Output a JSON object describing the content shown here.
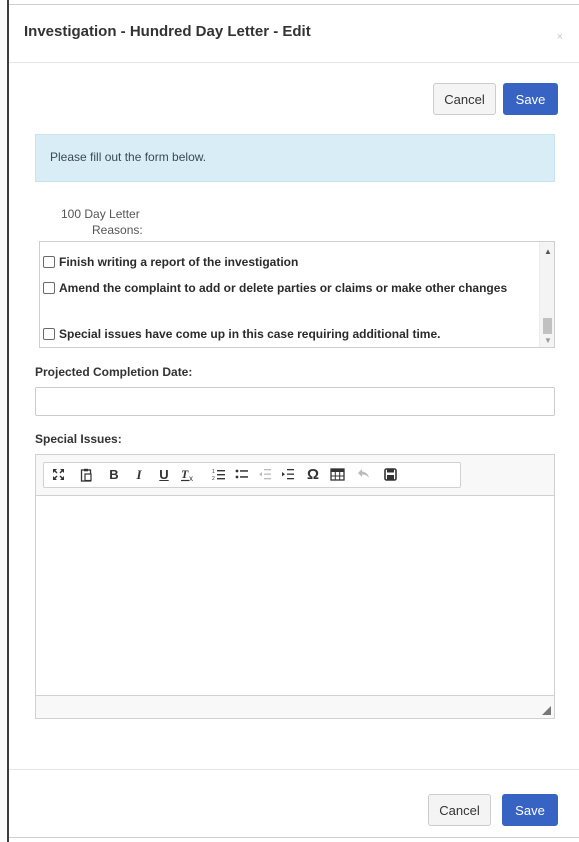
{
  "modal": {
    "title": "Investigation - Hundred Day Letter - Edit",
    "close_glyph": "×"
  },
  "actions": {
    "cancel_label": "Cancel",
    "save_label": "Save"
  },
  "alert": {
    "message": "Please fill out the form below."
  },
  "reasons": {
    "label_line1": "100 Day Letter",
    "label_line2": "Reasons:",
    "items": [
      {
        "label": "Finish writing a report of the investigation",
        "checked": false
      },
      {
        "label": "Amend the complaint to add or delete parties or claims or make other changes",
        "checked": false
      },
      {
        "label": "Special issues have come up in this case requiring additional time.",
        "checked": false
      }
    ]
  },
  "projected_completion": {
    "label": "Projected Completion Date:",
    "value": "",
    "placeholder": ""
  },
  "special_issues": {
    "label": "Special Issues:",
    "toolbar": [
      "maximize-icon",
      "paste-from-word-icon",
      "bold-icon",
      "italic-icon",
      "underline-icon",
      "remove-format-icon",
      "numbered-list-icon",
      "bulleted-list-icon",
      "decrease-indent-icon",
      "increase-indent-icon",
      "special-character-icon",
      "table-icon",
      "undo-icon",
      "save-icon"
    ],
    "body": ""
  },
  "colors": {
    "primary": "#3764c3",
    "alert_bg": "#d9edf7",
    "border": "#cccccc"
  }
}
